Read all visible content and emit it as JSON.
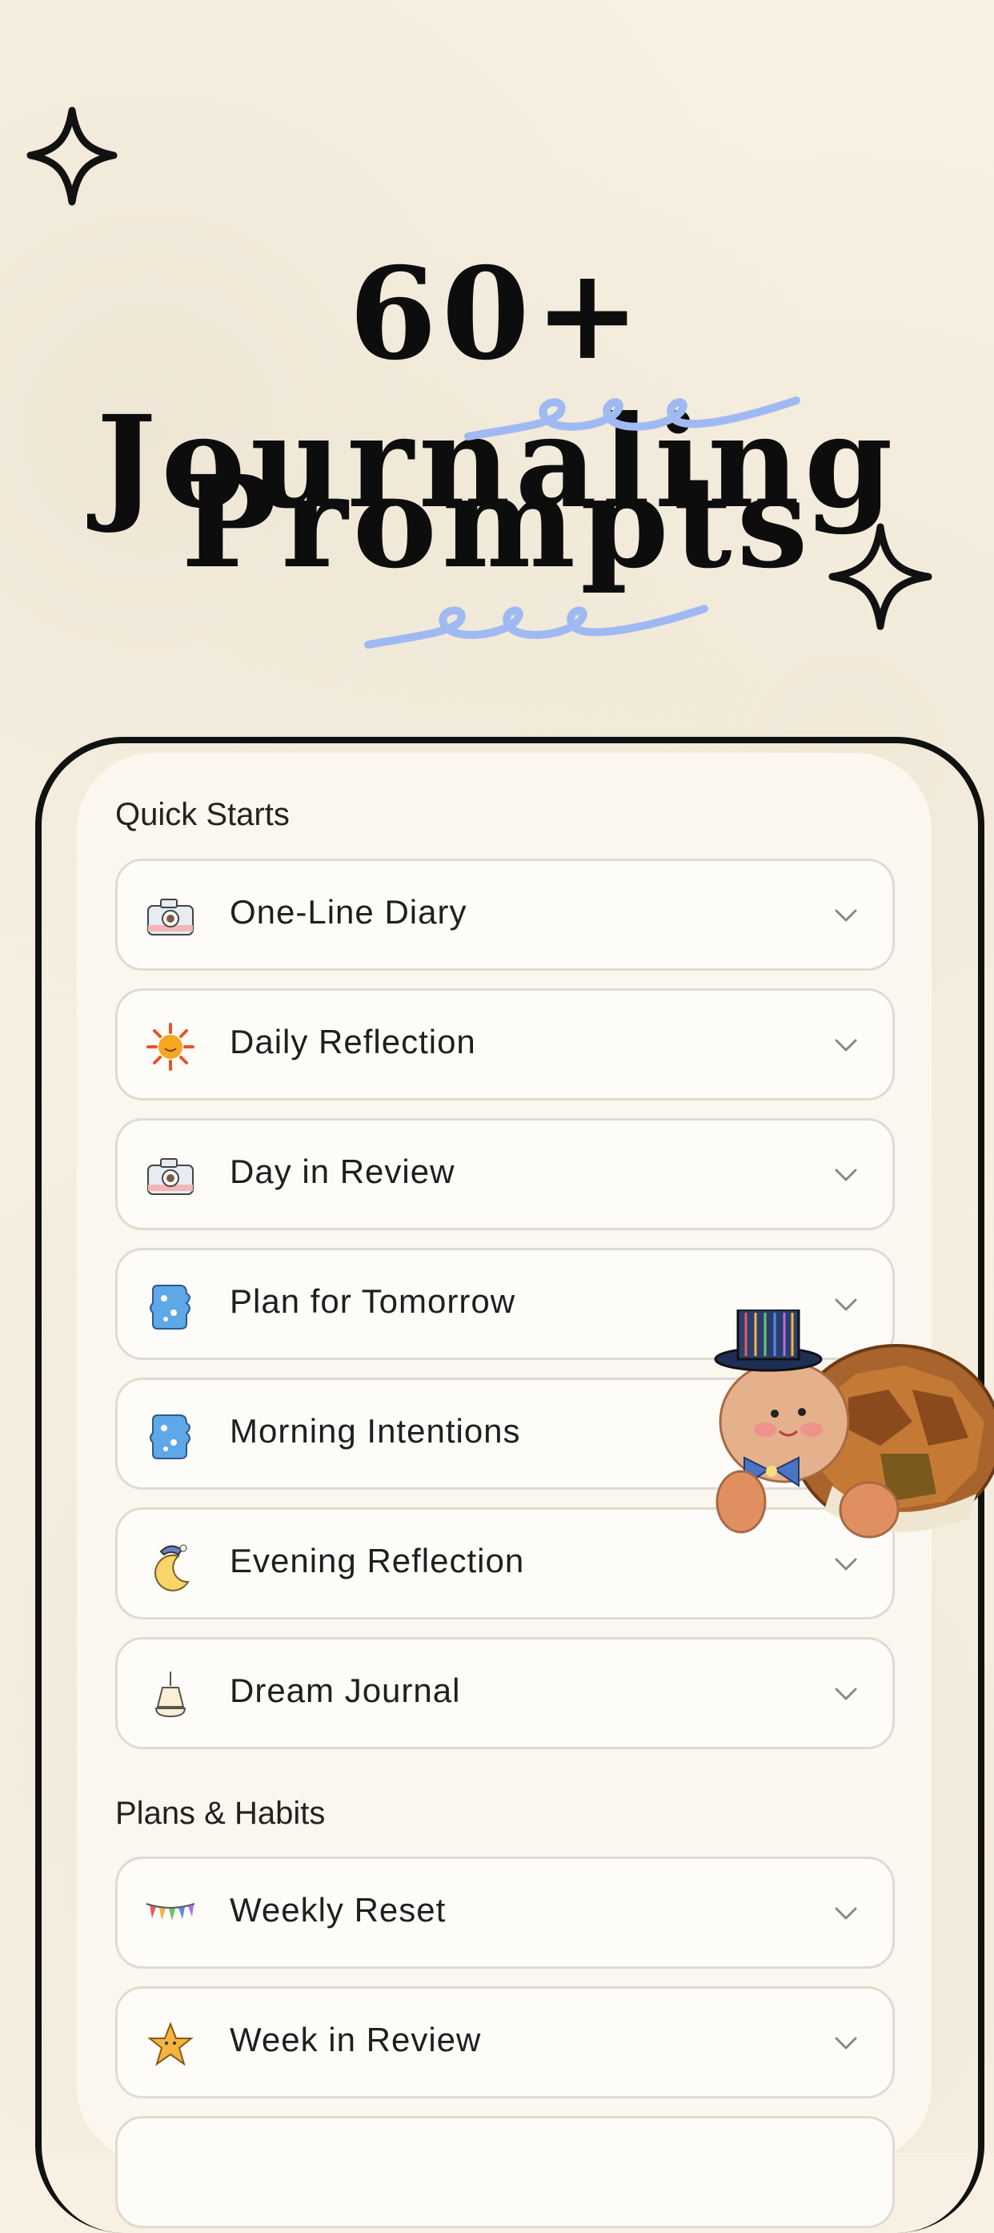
{
  "headline": {
    "line1": "60+ Journaling",
    "line2": "Prompts"
  },
  "sections": [
    {
      "title": "Quick Starts",
      "items": [
        {
          "label": "One-Line Diary",
          "icon": "camera-icon"
        },
        {
          "label": "Daily Reflection",
          "icon": "sun-icon"
        },
        {
          "label": "Day in Review",
          "icon": "camera-icon"
        },
        {
          "label": "Plan for Tomorrow",
          "icon": "blue-puzzle-icon"
        },
        {
          "label": "Morning Intentions",
          "icon": "blue-puzzle-icon"
        },
        {
          "label": "Evening Reflection",
          "icon": "moon-icon"
        },
        {
          "label": "Dream Journal",
          "icon": "lamp-icon"
        }
      ]
    },
    {
      "title": "Plans & Habits",
      "items": [
        {
          "label": "Weekly Reset",
          "icon": "bunting-icon"
        },
        {
          "label": "Week in Review",
          "icon": "star-icon"
        }
      ]
    }
  ],
  "colors": {
    "background": "#f8f1e3",
    "accent_squiggle": "#9fbaf2",
    "frame": "#111111"
  }
}
